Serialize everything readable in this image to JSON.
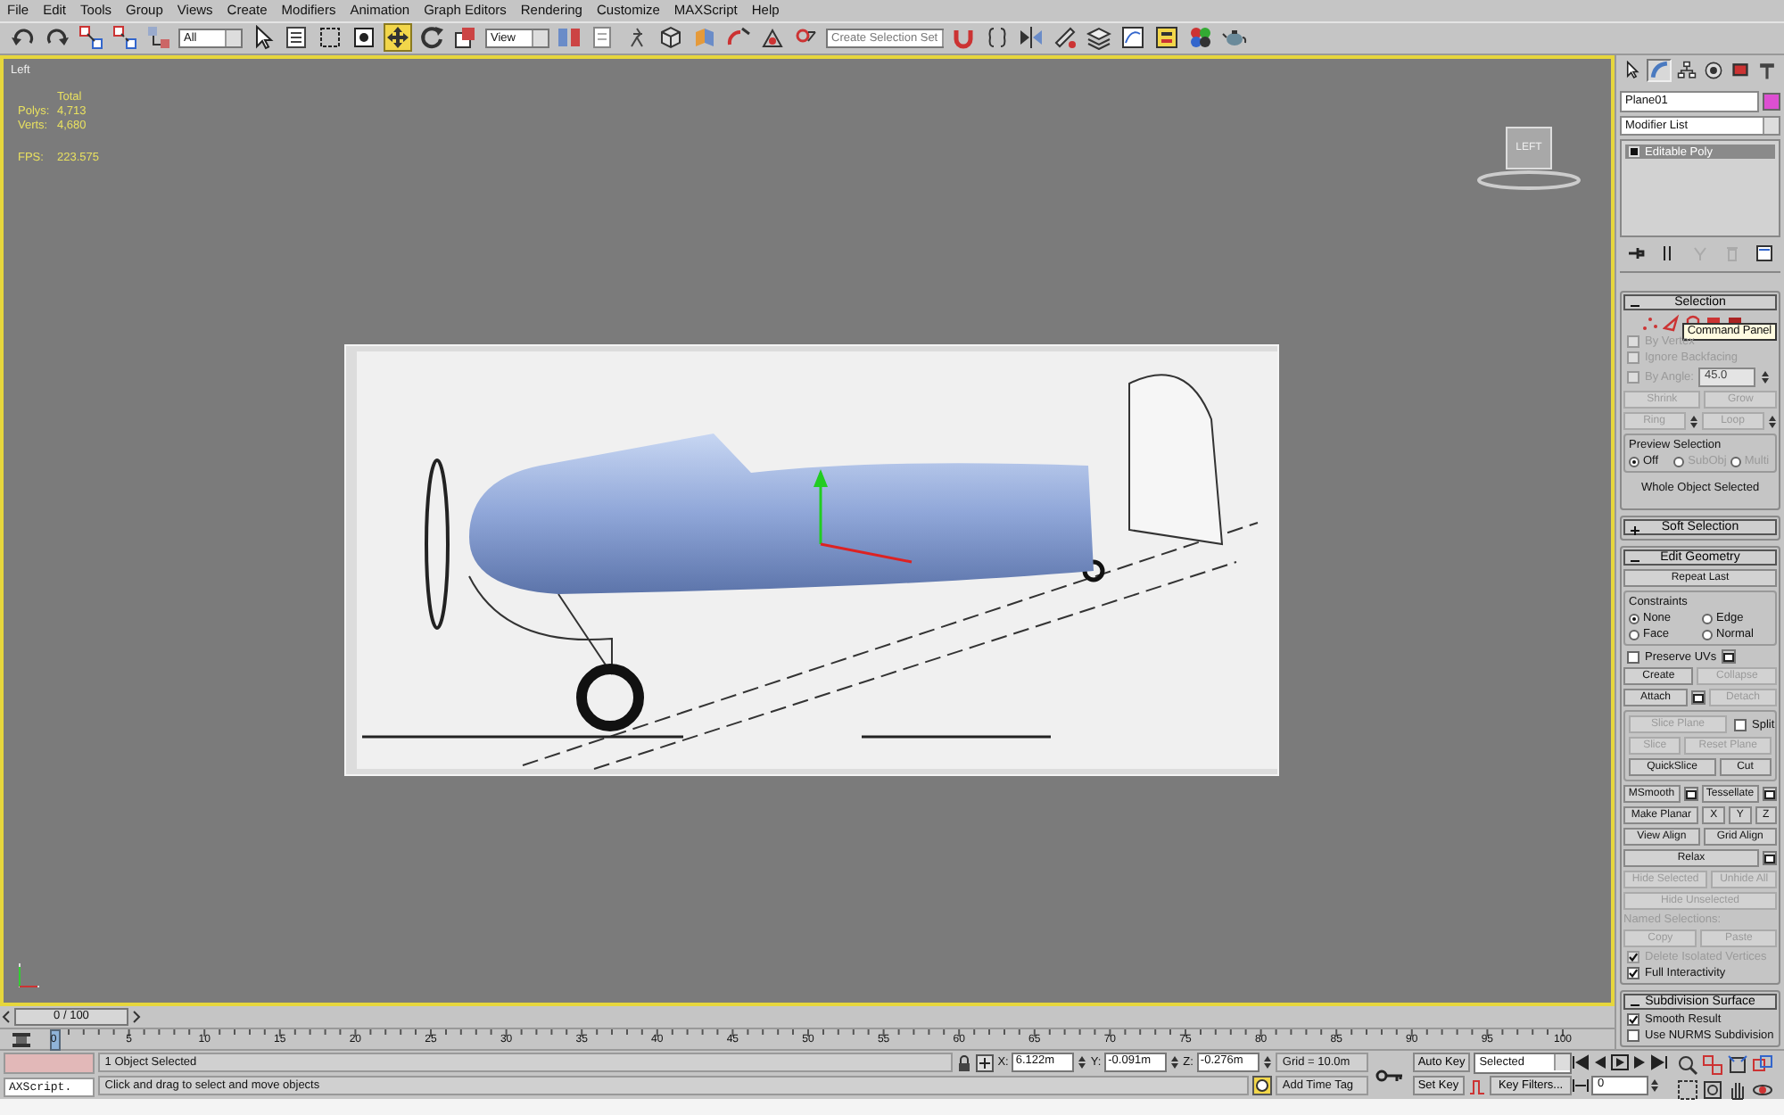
{
  "menu": [
    "File",
    "Edit",
    "Tools",
    "Group",
    "Views",
    "Create",
    "Modifiers",
    "Animation",
    "Graph Editors",
    "Rendering",
    "Customize",
    "MAXScript",
    "Help"
  ],
  "toolbar": [
    {
      "kind": "tool",
      "selected": false
    },
    {
      "kind": "tool",
      "selected": false
    },
    {
      "kind": "tool",
      "selected": false
    },
    {
      "kind": "tool",
      "selected": false
    },
    {
      "kind": "tool",
      "selected": false
    },
    {
      "kind": "dropdown",
      "value": "All"
    },
    {
      "kind": "tool",
      "selected": false
    },
    {
      "kind": "tool",
      "selected": false
    },
    {
      "kind": "tool",
      "selected": false
    },
    {
      "kind": "tool",
      "selected": false
    },
    {
      "kind": "tool",
      "selected": true
    },
    {
      "kind": "tool",
      "selected": false
    },
    {
      "kind": "tool",
      "selected": false
    },
    {
      "kind": "dropdown",
      "value": "View"
    },
    {
      "kind": "tool",
      "selected": false
    },
    {
      "kind": "tool",
      "selected": false
    },
    {
      "kind": "tool",
      "selected": false
    },
    {
      "kind": "tool",
      "selected": false
    },
    {
      "kind": "tool",
      "selected": false
    },
    {
      "kind": "tool",
      "selected": false
    },
    {
      "kind": "tool",
      "selected": false
    },
    {
      "kind": "tool",
      "selected": false
    },
    {
      "kind": "dropdown",
      "value": "Create Selection Set"
    },
    {
      "kind": "tool",
      "selected": false
    },
    {
      "kind": "tool",
      "selected": false
    },
    {
      "kind": "tool",
      "selected": false
    },
    {
      "kind": "tool",
      "selected": false
    },
    {
      "kind": "tool",
      "selected": false
    },
    {
      "kind": "tool",
      "selected": false
    },
    {
      "kind": "tool",
      "selected": false
    },
    {
      "kind": "tool",
      "selected": false
    },
    {
      "kind": "tool",
      "selected": false
    }
  ],
  "viewport": {
    "label": "Left",
    "stats_header": "Total",
    "stats": [
      {
        "label": "Polys:",
        "value": "4,713"
      },
      {
        "label": "Verts:",
        "value": "4,680"
      }
    ],
    "fps_label": "FPS:",
    "fps": "223.575",
    "viewcube": "LEFT"
  },
  "time_slider": {
    "label": "0 / 100",
    "level": 0
  },
  "track_bar": {
    "ticks": [
      "0",
      "5",
      "10",
      "15",
      "20",
      "25",
      "30",
      "35",
      "40",
      "45",
      "50",
      "55",
      "60",
      "65",
      "70",
      "75",
      "80",
      "85",
      "90",
      "95",
      "100"
    ]
  },
  "command_panel": {
    "tabs": [
      {
        "selected": false
      },
      {
        "selected": true
      },
      {
        "selected": false
      },
      {
        "selected": false
      },
      {
        "selected": false
      },
      {
        "selected": false
      }
    ],
    "object_name": "Plane01",
    "modifier_list": "Modifier List",
    "stack": [
      {
        "label": "Editable Poly",
        "selected": true
      }
    ],
    "rollouts": [
      {
        "title": "Selection",
        "expanded": true,
        "rows": [
          [
            {
              "kind": "subobjects",
              "tooltip": "Command Panel"
            }
          ],
          [
            {
              "kind": "checkbox",
              "label": "By Vertex",
              "checked": false,
              "disabled": true
            }
          ],
          [
            {
              "kind": "checkbox",
              "label": "Ignore Backfacing",
              "checked": false,
              "disabled": true
            }
          ],
          [
            {
              "kind": "checkbox",
              "label": "By Angle:",
              "checked": false,
              "disabled": true,
              "value": "45.0"
            }
          ],
          [
            {
              "kind": "button",
              "label": "Shrink",
              "disabled": true
            },
            {
              "kind": "button",
              "label": "Grow",
              "disabled": true
            }
          ],
          [
            {
              "kind": "button",
              "label": "Ring",
              "disabled": true,
              "spinner": true
            },
            {
              "kind": "button",
              "label": "Loop",
              "disabled": true,
              "spinner": true
            }
          ],
          [
            {
              "kind": "group",
              "title": "Preview Selection",
              "rows": [
                [
                  {
                    "kind": "radio",
                    "label": "Off",
                    "selected": true,
                    "disabled": false
                  },
                  {
                    "kind": "radio",
                    "label": "SubObj",
                    "selected": false,
                    "disabled": true
                  },
                  {
                    "kind": "radio",
                    "label": "Multi",
                    "selected": false,
                    "disabled": true
                  }
                ]
              ]
            }
          ],
          [
            {
              "kind": "label",
              "label": "Whole Object Selected",
              "disabled": false
            }
          ]
        ]
      },
      {
        "title": "Soft Selection",
        "expanded": false
      },
      {
        "title": "Edit Geometry",
        "expanded": true,
        "rows": [
          [
            {
              "kind": "button",
              "label": "Repeat Last",
              "disabled": false
            }
          ],
          [
            {
              "kind": "group",
              "title": "Constraints",
              "rows": [
                [
                  {
                    "kind": "radio",
                    "label": "None",
                    "selected": true,
                    "disabled": false
                  },
                  {
                    "kind": "radio",
                    "label": "Edge",
                    "selected": false,
                    "disabled": false
                  }
                ],
                [
                  {
                    "kind": "radio",
                    "label": "Face",
                    "selected": false,
                    "disabled": false
                  },
                  {
                    "kind": "radio",
                    "label": "Normal",
                    "selected": false,
                    "disabled": false
                  }
                ]
              ]
            }
          ],
          [
            {
              "kind": "checkbox",
              "label": "Preserve UVs",
              "checked": false,
              "disabled": false,
              "settings": true
            }
          ],
          [
            {
              "kind": "button",
              "label": "Create",
              "disabled": false
            },
            {
              "kind": "button",
              "label": "Collapse",
              "disabled": true
            }
          ],
          [
            {
              "kind": "button",
              "label": "Attach",
              "disabled": false,
              "settings": true
            },
            {
              "kind": "button",
              "label": "Detach",
              "disabled": true
            }
          ],
          [
            {
              "kind": "group",
              "rows": [
                [
                  {
                    "kind": "button",
                    "label": "Slice Plane",
                    "disabled": true
                  },
                  {
                    "kind": "checkbox",
                    "label": "Split",
                    "checked": false,
                    "disabled": false
                  }
                ],
                [
                  {
                    "kind": "button",
                    "label": "Slice",
                    "disabled": true
                  },
                  {
                    "kind": "button",
                    "label": "Reset Plane",
                    "disabled": true
                  }
                ],
                [
                  {
                    "kind": "button",
                    "label": "QuickSlice",
                    "disabled": false
                  },
                  {
                    "kind": "button",
                    "label": "Cut",
                    "disabled": false
                  }
                ]
              ]
            }
          ],
          [
            {
              "kind": "button",
              "label": "MSmooth",
              "disabled": false,
              "settings": true
            },
            {
              "kind": "button",
              "label": "Tessellate",
              "disabled": false,
              "settings": true
            }
          ],
          [
            {
              "kind": "button",
              "label": "Make Planar",
              "disabled": false
            },
            {
              "kind": "button",
              "label": "X",
              "disabled": false
            },
            {
              "kind": "button",
              "label": "Y",
              "disabled": false
            },
            {
              "kind": "button",
              "label": "Z",
              "disabled": false
            }
          ],
          [
            {
              "kind": "button",
              "label": "View Align",
              "disabled": false
            },
            {
              "kind": "button",
              "label": "Grid Align",
              "disabled": false
            }
          ],
          [
            {
              "kind": "button",
              "label": "Relax",
              "disabled": false,
              "settings": true
            }
          ],
          [
            {
              "kind": "button",
              "label": "Hide Selected",
              "disabled": true
            },
            {
              "kind": "button",
              "label": "Unhide All",
              "disabled": true
            }
          ],
          [
            {
              "kind": "button",
              "label": "Hide Unselected",
              "disabled": true
            }
          ],
          [
            {
              "kind": "label",
              "label": "Named Selections:",
              "disabled": true
            }
          ],
          [
            {
              "kind": "button",
              "label": "Copy",
              "disabled": true
            },
            {
              "kind": "button",
              "label": "Paste",
              "disabled": true
            }
          ],
          [
            {
              "kind": "checkbox",
              "label": "Delete Isolated Vertices",
              "checked": true,
              "disabled": true
            }
          ],
          [
            {
              "kind": "checkbox",
              "label": "Full Interactivity",
              "checked": true,
              "disabled": false
            }
          ]
        ]
      },
      {
        "title": "Subdivision Surface",
        "expanded": true,
        "rows": [
          [
            {
              "kind": "checkbox",
              "label": "Smooth Result",
              "checked": true,
              "disabled": false
            }
          ],
          [
            {
              "kind": "checkbox",
              "label": "Use NURMS Subdivision",
              "checked": false,
              "disabled": false
            }
          ]
        ]
      }
    ]
  },
  "status": {
    "listener": "AXScript.",
    "selection": "1 Object Selected",
    "prompt": "Click and drag to select and move objects",
    "coords": [
      {
        "axis": "X:",
        "value": "6.122m"
      },
      {
        "axis": "Y:",
        "value": "-0.091m"
      },
      {
        "axis": "Z:",
        "value": "-0.276m"
      }
    ],
    "grid": "Grid = 10.0m",
    "time_tag": "Add Time Tag",
    "auto_key": "Auto Key",
    "key_mode": "Selected",
    "set_key": "Set Key",
    "key_filters": "Key Filters...",
    "frame": "0"
  }
}
